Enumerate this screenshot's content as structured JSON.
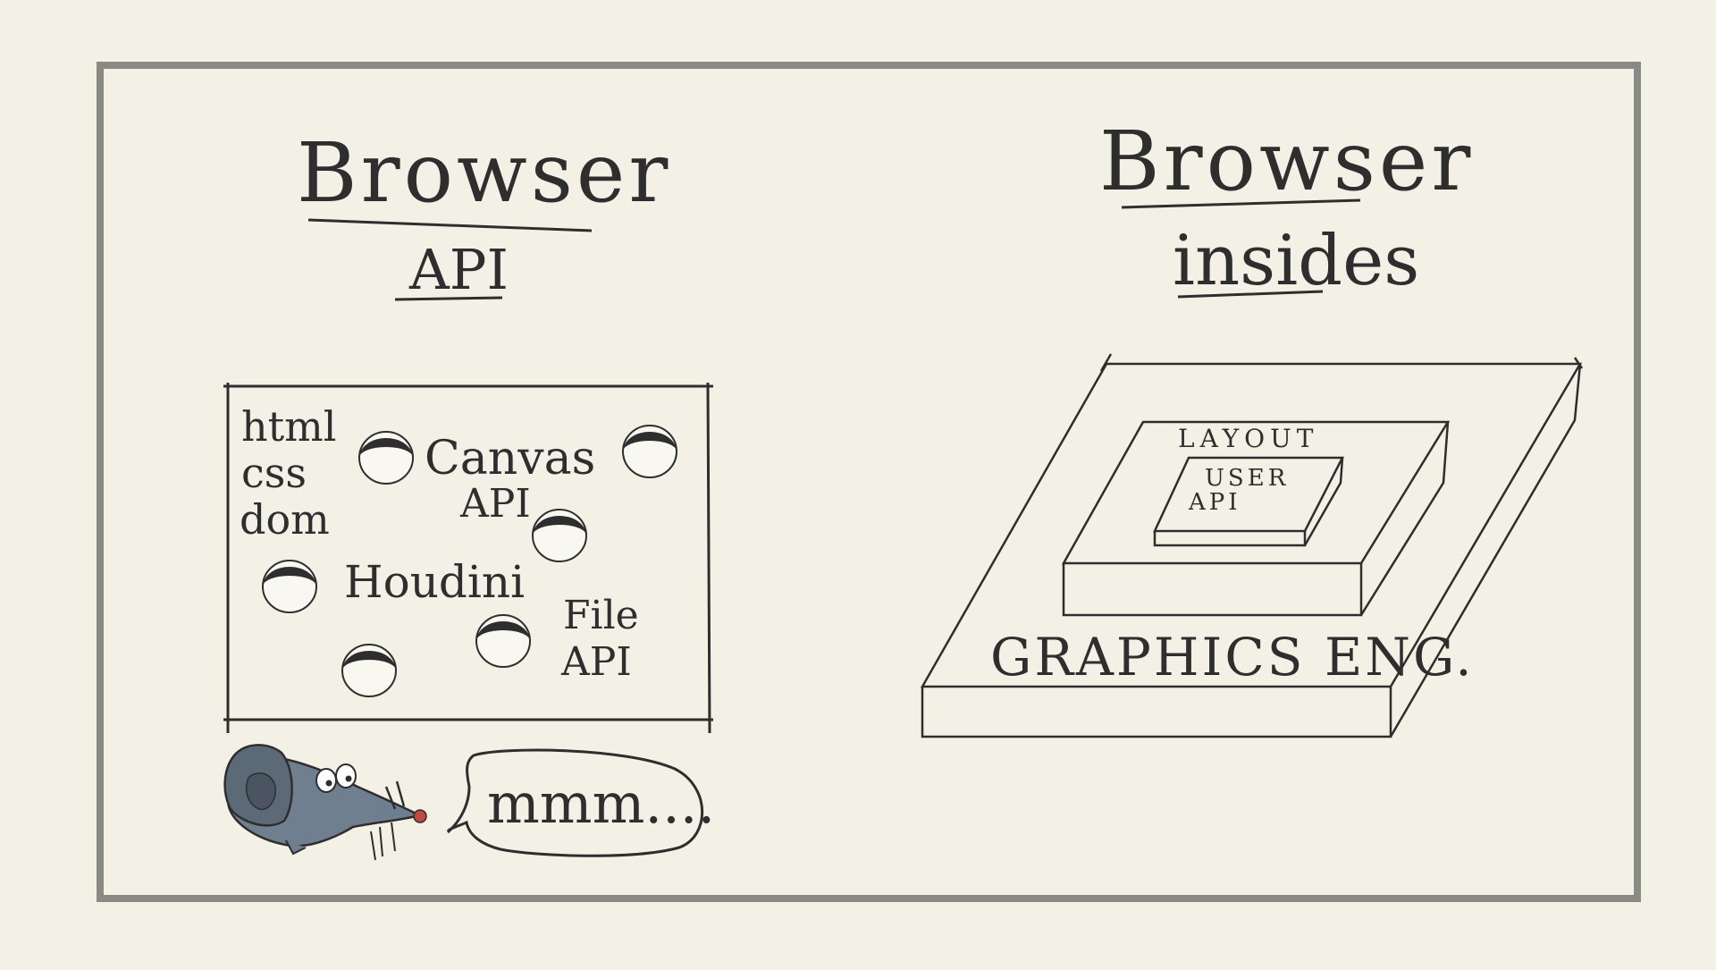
{
  "colors": {
    "background": "#f3f1e6",
    "frame": "#8a8a84",
    "ink": "#2e2e2e",
    "mouse_body": "#6f7f8f",
    "mouse_nose": "#c2493c"
  },
  "left": {
    "title": "Browser",
    "subtitle": "API",
    "box_labels": {
      "html": "html",
      "css": "css",
      "dom": "dom",
      "canvas": "Canvas",
      "canvas_api": "API",
      "houdini": "Houdini",
      "file": "File",
      "file_api": "API"
    },
    "speech": "mmm...."
  },
  "right": {
    "title": "Browser",
    "subtitle": "insides",
    "layers": {
      "outer": "GRAPHICS ENG.",
      "middle": "LAYOUT",
      "inner_line1": "USER",
      "inner_line2": "API"
    }
  },
  "icons": [
    "mouse-icon",
    "hole-icon"
  ]
}
